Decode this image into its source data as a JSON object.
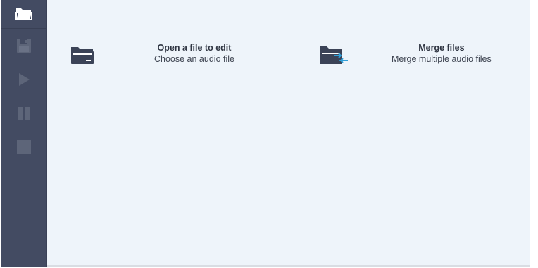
{
  "sidebar": {
    "items": [
      {
        "icon": "folder-open-icon",
        "state": "active"
      },
      {
        "icon": "save-icon",
        "state": "disabled"
      },
      {
        "icon": "play-icon",
        "state": "disabled"
      },
      {
        "icon": "pause-icon",
        "state": "disabled"
      },
      {
        "icon": "stop-icon",
        "state": "disabled"
      }
    ]
  },
  "main": {
    "open": {
      "title": "Open a file to edit",
      "description": "Choose an audio file",
      "icon": "folder-icon"
    },
    "merge": {
      "title": "Merge files",
      "description": "Merge multiple audio files",
      "icon": "folder-merge-icon"
    }
  },
  "colors": {
    "sidebar_bg": "#434b62",
    "content_bg": "#eef4fa",
    "icon_dark": "#3b4357",
    "accent_blue": "#2f9fd8",
    "disabled_icon": "#5d6579"
  }
}
